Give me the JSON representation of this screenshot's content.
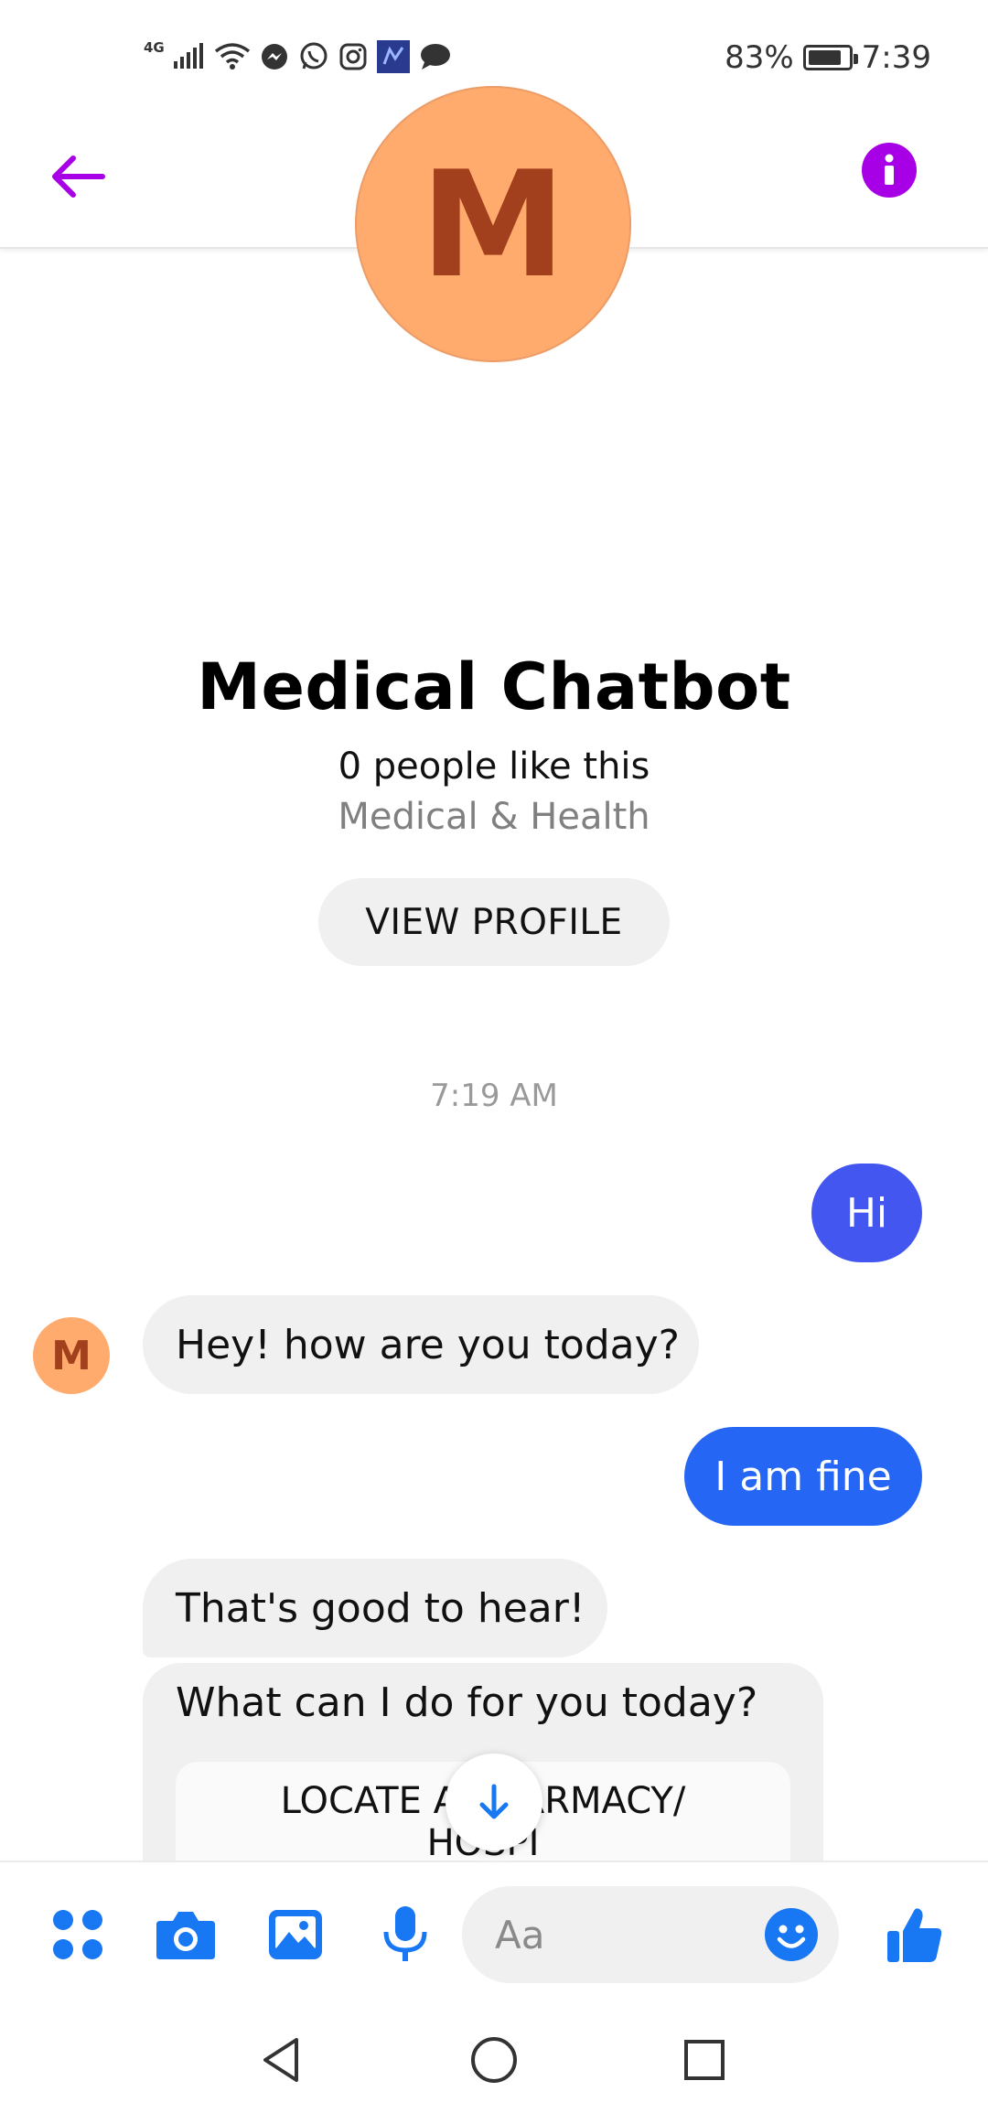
{
  "status_bar": {
    "network": "4G",
    "battery_percent": "83%",
    "battery_level": 0.83,
    "time": "7:39",
    "notification_icons": [
      "messenger-icon",
      "whatsapp-icon",
      "instagram-icon",
      "app-icon",
      "chat-icon"
    ]
  },
  "header": {
    "back_icon": "arrow-left-icon",
    "info_icon": "info-icon",
    "accent_color": "#a800e6"
  },
  "profile": {
    "avatar_letter": "M",
    "name": "Medical Chatbot",
    "likes": "0 people like this",
    "category": "Medical & Health",
    "view_profile_label": "VIEW PROFILE"
  },
  "conversation": {
    "timestamp": "7:19 AM",
    "bot_avatar_letter": "M",
    "messages": [
      {
        "sender": "user",
        "text": "Hi"
      },
      {
        "sender": "bot",
        "text": "Hey! how are you today?"
      },
      {
        "sender": "user",
        "text": "I am fine"
      },
      {
        "sender": "bot",
        "text": "That's good to hear!"
      },
      {
        "sender": "bot",
        "text": "What can I do for you today?"
      }
    ],
    "quick_reply": "LOCATE A PHARMACY/ HOSPI"
  },
  "composer": {
    "placeholder": "Aa",
    "icons": [
      "apps-icon",
      "camera-icon",
      "gallery-icon",
      "microphone-icon",
      "emoji-icon",
      "thumbs-up-icon"
    ],
    "icon_color": "#1877f2"
  },
  "nav_bar": {
    "icons": [
      "back-triangle-icon",
      "home-circle-icon",
      "recents-square-icon"
    ]
  }
}
